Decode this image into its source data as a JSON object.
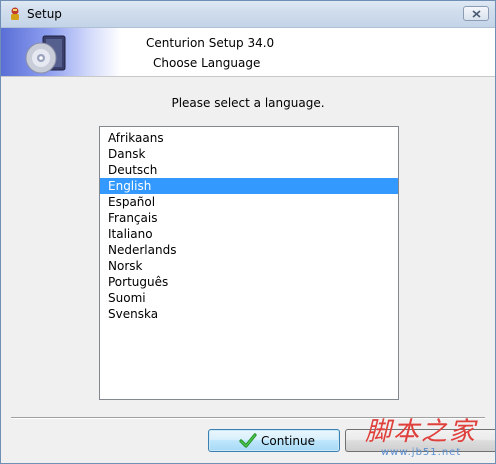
{
  "window": {
    "title": "Setup",
    "app_icon": "setup-knight-icon",
    "close_icon": "close-icon"
  },
  "header": {
    "title": "Centurion Setup 34.0",
    "subtitle": "Choose Language",
    "art_icon": "cd-disc-icon"
  },
  "prompt": "Please select a language.",
  "languages": {
    "selected": "English",
    "items": [
      "Afrikaans",
      "Dansk",
      "Deutsch",
      "English",
      "Español",
      "Français",
      "Italiano",
      "Nederlands",
      "Norsk",
      "Português",
      "Suomi",
      "Svenska"
    ]
  },
  "footer": {
    "continue_label": "Continue",
    "continue_icon": "checkmark-icon"
  },
  "watermark": {
    "text": "脚本之家",
    "url": "www.jb51.net"
  },
  "colors": {
    "selection": "#3399ff",
    "titlebar": "#cfdcec",
    "watermark_red": "#e0403c",
    "watermark_blue": "#5b8fd0"
  }
}
